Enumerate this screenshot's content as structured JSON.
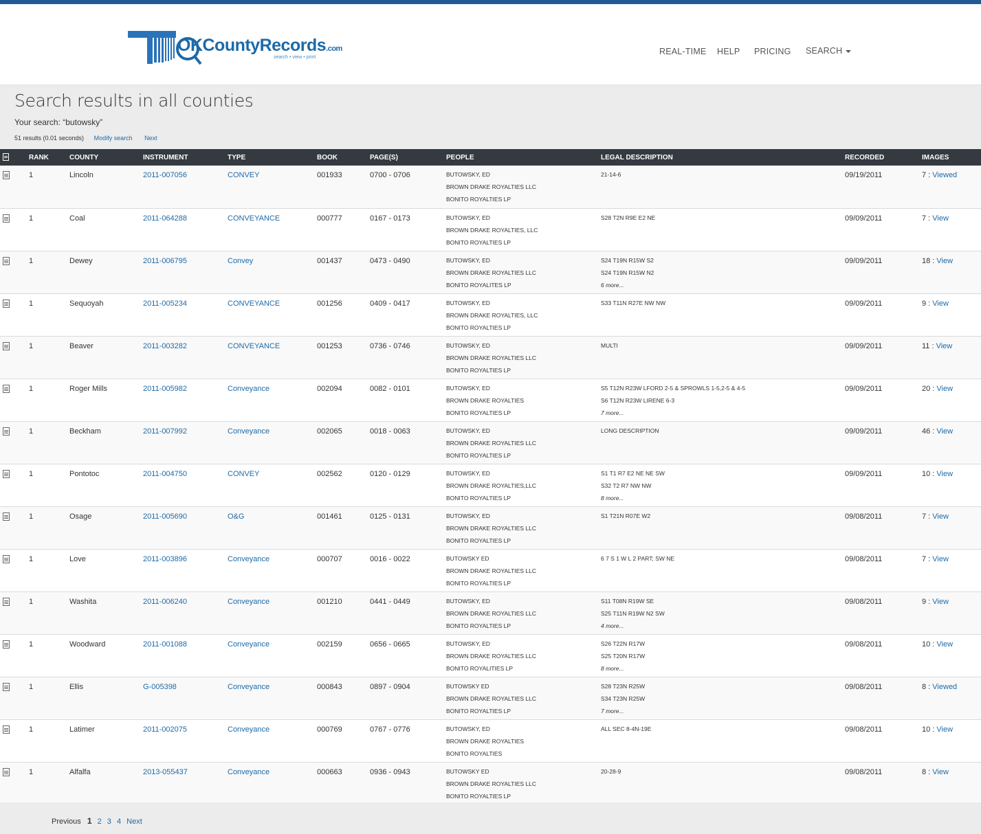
{
  "header": {
    "logo_text": "OKCountyRecords",
    "logo_suffix": ".com",
    "logo_tagline": "search • view • print",
    "nav": [
      "REAL-TIME",
      "HELP",
      "PRICING",
      "SEARCH"
    ]
  },
  "page": {
    "title": "Search results in all counties",
    "search_text": "Your search: “butowsky”",
    "results_count": "51 results (0.01 seconds)",
    "modify_label": "Modify search",
    "next_label": "Next"
  },
  "table": {
    "headers": [
      "RANK",
      "COUNTY",
      "INSTRUMENT",
      "TYPE",
      "BOOK",
      "PAGE(S)",
      "PEOPLE",
      "LEGAL DESCRIPTION",
      "RECORDED",
      "IMAGES"
    ],
    "rows": [
      {
        "rank": "1",
        "county": "Lincoln",
        "instrument": "2011-007056",
        "type": "CONVEY",
        "book": "001933",
        "pages": "0700 - 0706",
        "people": [
          "BUTOWSKY, ED",
          "BROWN DRAKE ROYALTIES LLC",
          "BONITO ROYALTIES LP"
        ],
        "legal": [
          "21-14-6"
        ],
        "more": "",
        "recorded": "09/19/2011",
        "images_count": "7 :",
        "images_link": "Viewed"
      },
      {
        "rank": "1",
        "county": "Coal",
        "instrument": "2011-064288",
        "type": "CONVEYANCE",
        "book": "000777",
        "pages": "0167 - 0173",
        "people": [
          "BUTOWSKY, ED",
          "BROWN DRAKE ROYALTIES, LLC",
          "BONITO ROYALTIES LP"
        ],
        "legal": [
          "S28 T2N R9E E2 NE"
        ],
        "more": "",
        "recorded": "09/09/2011",
        "images_count": "7 :",
        "images_link": "View"
      },
      {
        "rank": "1",
        "county": "Dewey",
        "instrument": "2011-006795",
        "type": "Convey",
        "book": "001437",
        "pages": "0473 - 0490",
        "people": [
          "BUTOWSKY, ED",
          "BROWN DRAKE ROYALTIES LLC",
          "BONITO ROYALITES LP"
        ],
        "legal": [
          "S24 T19N R15W S2",
          "S24 T19N R15W N2"
        ],
        "more": "6 more...",
        "recorded": "09/09/2011",
        "images_count": "18 :",
        "images_link": "View"
      },
      {
        "rank": "1",
        "county": "Sequoyah",
        "instrument": "2011-005234",
        "type": "CONVEYANCE",
        "book": "001256",
        "pages": "0409 - 0417",
        "people": [
          "BUTOWSKY, ED",
          "BROWN DRAKE ROYALTIES, LLC",
          "BONITO ROYALTIES LP"
        ],
        "legal": [
          "S33 T11N R27E NW NW"
        ],
        "more": "",
        "recorded": "09/09/2011",
        "images_count": "9 :",
        "images_link": "View"
      },
      {
        "rank": "1",
        "county": "Beaver",
        "instrument": "2011-003282",
        "type": "CONVEYANCE",
        "book": "001253",
        "pages": "0736 - 0746",
        "people": [
          "BUTOWSKY, ED",
          "BROWN DRAKE ROYALTIES LLC",
          "BONITO ROYALTIES LP"
        ],
        "legal": [
          "MULTI"
        ],
        "more": "",
        "recorded": "09/09/2011",
        "images_count": "11 :",
        "images_link": "View"
      },
      {
        "rank": "1",
        "county": "Roger Mills",
        "instrument": "2011-005982",
        "type": "Conveyance",
        "book": "002094",
        "pages": "0082 - 0101",
        "people": [
          "BUTOWSKY, ED",
          "BROWN DRAKE ROYALTIES",
          "BONITO ROYALTIES LP"
        ],
        "legal": [
          "S5 T12N R23W LFORD 2-5 & SPROWLS 1-5,2-5 & 4-5",
          "S6 T12N R23W LIRENE 6-3"
        ],
        "more": "7 more...",
        "recorded": "09/09/2011",
        "images_count": "20 :",
        "images_link": "View"
      },
      {
        "rank": "1",
        "county": "Beckham",
        "instrument": "2011-007992",
        "type": "Conveyance",
        "book": "002065",
        "pages": "0018 - 0063",
        "people": [
          "BUTOWSKY, ED",
          "BROWN DRAKE ROYALTIES LLC",
          "BONITO ROYALTIES LP"
        ],
        "legal": [
          "LONG DESCRIPTION"
        ],
        "more": "",
        "recorded": "09/09/2011",
        "images_count": "46 :",
        "images_link": "View"
      },
      {
        "rank": "1",
        "county": "Pontotoc",
        "instrument": "2011-004750",
        "type": "CONVEY",
        "book": "002562",
        "pages": "0120 - 0129",
        "people": [
          "BUTOWSKY, ED",
          "BROWN DRAKE ROYALTIES,LLC",
          "BONITO ROYALTIES LP"
        ],
        "legal": [
          "S1 T1 R7 E2 NE NE SW",
          "S32 T2 R7 NW NW"
        ],
        "more": "8 more...",
        "recorded": "09/09/2011",
        "images_count": "10 :",
        "images_link": "View"
      },
      {
        "rank": "1",
        "county": "Osage",
        "instrument": "2011-005690",
        "type": "O&G",
        "book": "001461",
        "pages": "0125 - 0131",
        "people": [
          "BUTOWSKY, ED",
          "BROWN DRAKE ROYALTIES LLC",
          "BONITO ROYALTIES LP"
        ],
        "legal": [
          "S1 T21N R07E W2"
        ],
        "more": "",
        "recorded": "09/08/2011",
        "images_count": "7 :",
        "images_link": "View"
      },
      {
        "rank": "1",
        "county": "Love",
        "instrument": "2011-003896",
        "type": "Conveyance",
        "book": "000707",
        "pages": "0016 - 0022",
        "people": [
          "BUTOWSKY ED",
          "BROWN DRAKE ROYALTIES LLC",
          "BONITO ROYALTIES LP"
        ],
        "legal": [
          "6 7 S 1 W L 2 PART; SW NE"
        ],
        "more": "",
        "recorded": "09/08/2011",
        "images_count": "7 :",
        "images_link": "View"
      },
      {
        "rank": "1",
        "county": "Washita",
        "instrument": "2011-006240",
        "type": "Conveyance",
        "book": "001210",
        "pages": "0441 - 0449",
        "people": [
          "BUTOWSKY, ED",
          "BROWN DRAKE ROYALTIES LLC",
          "BONITO ROYALTIES LP"
        ],
        "legal": [
          "S11 T08N R19W SE",
          "S25 T11N R19W N2 SW"
        ],
        "more": "4 more...",
        "recorded": "09/08/2011",
        "images_count": "9 :",
        "images_link": "View"
      },
      {
        "rank": "1",
        "county": "Woodward",
        "instrument": "2011-001088",
        "type": "Conveyance",
        "book": "002159",
        "pages": "0656 - 0665",
        "people": [
          "BUTOWSKY, ED",
          "BROWN DRAKE ROYALTIES LLC",
          "BONITO ROYALITIES LP"
        ],
        "legal": [
          "S26 T22N R17W",
          "S25 T20N R17W"
        ],
        "more": "8 more...",
        "recorded": "09/08/2011",
        "images_count": "10 :",
        "images_link": "View"
      },
      {
        "rank": "1",
        "county": "Ellis",
        "instrument": "G-005398",
        "type": "Conveyance",
        "book": "000843",
        "pages": "0897 - 0904",
        "people": [
          "BUTOWSKY ED",
          "BROWN DRAKE ROYALTIES LLC",
          "BONITO ROYALTIES LP"
        ],
        "legal": [
          "S28 T23N R25W",
          "S34 T23N R25W"
        ],
        "more": "7 more...",
        "recorded": "09/08/2011",
        "images_count": "8 :",
        "images_link": "Viewed"
      },
      {
        "rank": "1",
        "county": "Latimer",
        "instrument": "2011-002075",
        "type": "Conveyance",
        "book": "000769",
        "pages": "0767 - 0776",
        "people": [
          "BUTOWSKY, ED",
          "BROWN DRAKE ROYALTIES",
          "BONITO ROYALTIES"
        ],
        "legal": [
          "ALL SEC 8-4N-19E"
        ],
        "more": "",
        "recorded": "09/08/2011",
        "images_count": "10 :",
        "images_link": "View"
      },
      {
        "rank": "1",
        "county": "Alfalfa",
        "instrument": "2013-055437",
        "type": "Conveyance",
        "book": "000663",
        "pages": "0936 - 0943",
        "people": [
          "BUTOWSKY ED",
          "BROWN DRAKE ROYALTIES LLC",
          "BONITO ROYALTIES LP"
        ],
        "legal": [
          "20-28-9"
        ],
        "more": "",
        "recorded": "09/08/2011",
        "images_count": "8 :",
        "images_link": "View"
      }
    ]
  },
  "pager": {
    "previous": "Previous",
    "current": "1",
    "pages": [
      "2",
      "3",
      "4"
    ],
    "next": "Next"
  },
  "colors": {
    "brand": "#1f5a96",
    "link": "#1d6aa8",
    "table_header": "#343a40"
  }
}
